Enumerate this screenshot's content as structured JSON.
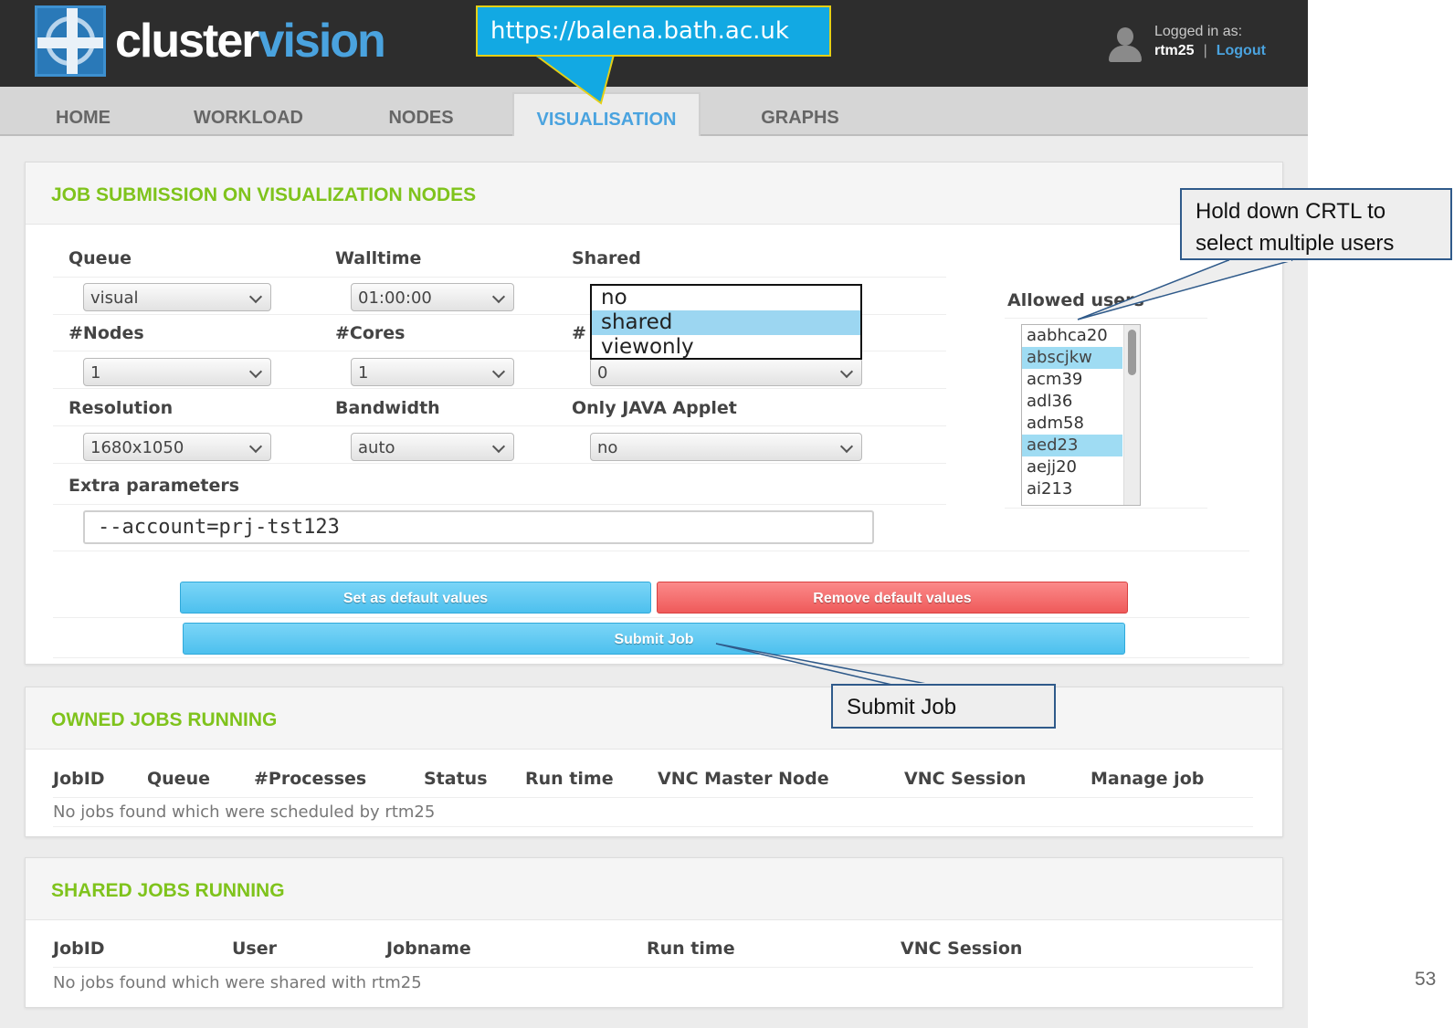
{
  "brand": {
    "name_part1": "cluster",
    "name_part2": "vision"
  },
  "user": {
    "logged_in_label": "Logged in as:",
    "username": "rtm25",
    "separator": "|",
    "logout_label": "Logout"
  },
  "nav": {
    "tabs": [
      {
        "label": "HOME"
      },
      {
        "label": "WORKLOAD"
      },
      {
        "label": "NODES"
      },
      {
        "label": "VISUALISATION",
        "active": true
      },
      {
        "label": "GRAPHS"
      }
    ]
  },
  "job_submission": {
    "title": "JOB SUBMISSION ON VISUALIZATION NODES",
    "fields": {
      "queue": {
        "label": "Queue",
        "value": "visual"
      },
      "walltime": {
        "label": "Walltime",
        "value": "01:00:00"
      },
      "shared": {
        "label": "Shared",
        "options": [
          "no",
          "shared",
          "viewonly"
        ],
        "highlighted": "shared"
      },
      "nodes": {
        "label": "#Nodes",
        "value": "1"
      },
      "cores": {
        "label": "#Cores",
        "value": "1"
      },
      "third_col": {
        "label_partial": "#",
        "value": "0"
      },
      "resolution": {
        "label": "Resolution",
        "value": "1680x1050"
      },
      "bandwidth": {
        "label": "Bandwidth",
        "value": "auto"
      },
      "java_applet": {
        "label": "Only JAVA Applet",
        "value": "no"
      },
      "extra_params": {
        "label": "Extra parameters",
        "value": "--account=prj-tst123"
      },
      "allowed_users": {
        "label": "Allowed users",
        "items": [
          "aabhca20",
          "abscjkw",
          "acm39",
          "adl36",
          "adm58",
          "aed23",
          "aejj20",
          "ai213"
        ],
        "selected": [
          "abscjkw",
          "aed23"
        ]
      }
    },
    "buttons": {
      "set_default": "Set as default values",
      "remove_default": "Remove default values",
      "submit": "Submit Job"
    }
  },
  "owned_jobs": {
    "title": "OWNED JOBS RUNNING",
    "columns": [
      "JobID",
      "Queue",
      "#Processes",
      "Status",
      "Run time",
      "VNC Master Node",
      "VNC Session",
      "Manage job"
    ],
    "empty_message": "No jobs found which were scheduled by rtm25"
  },
  "shared_jobs": {
    "title": "SHARED JOBS RUNNING",
    "columns": [
      "JobID",
      "User",
      "Jobname",
      "Run time",
      "VNC Session"
    ],
    "empty_message": "No jobs found which were shared with rtm25"
  },
  "annotations": {
    "url": "https://balena.bath.ac.uk",
    "multi_select_hint_line1": "Hold down CRTL to",
    "multi_select_hint_line2": "select multiple users",
    "submit_hint": "Submit Job"
  },
  "slide_number": "53",
  "colors": {
    "accent_blue": "#4aa3df",
    "heading_green": "#7fc31c",
    "callout_blue": "#12a9e3",
    "button_blue": "#5ec8f2",
    "button_red": "#f26464"
  }
}
